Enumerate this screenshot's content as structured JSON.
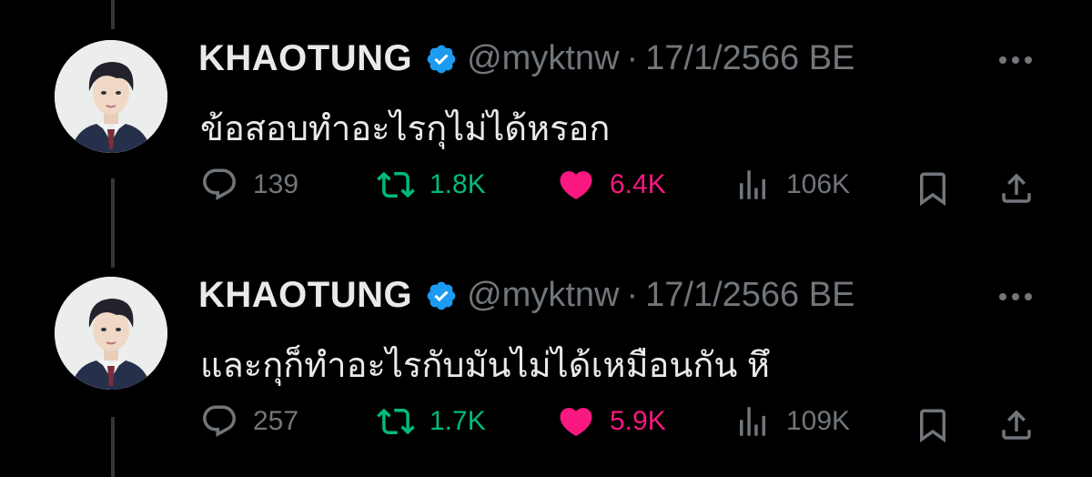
{
  "colors": {
    "background": "#000000",
    "text": "#e7e9ea",
    "muted": "#71767b",
    "repost": "#00ba7c",
    "like": "#f91880",
    "verified": "#1d9bf0"
  },
  "icons": [
    "reply-icon",
    "repost-icon",
    "heart-icon",
    "views-icon",
    "bookmark-icon",
    "share-icon",
    "verified-badge-icon",
    "more-icon"
  ],
  "tweets": [
    {
      "name": "KHAOTUNG",
      "handle": "@myktnw",
      "separator": "·",
      "date": "17/1/2566 BE",
      "text": "ข้อสอบทำอะไรกุไม่ได้หรอก",
      "replies": "139",
      "reposts": "1.8K",
      "likes": "6.4K",
      "views": "106K"
    },
    {
      "name": "KHAOTUNG",
      "handle": "@myktnw",
      "separator": "·",
      "date": "17/1/2566 BE",
      "text": "และกุก็ทำอะไรกับมันไม่ได้เหมือนกัน หึ",
      "replies": "257",
      "reposts": "1.7K",
      "likes": "5.9K",
      "views": "109K"
    }
  ]
}
